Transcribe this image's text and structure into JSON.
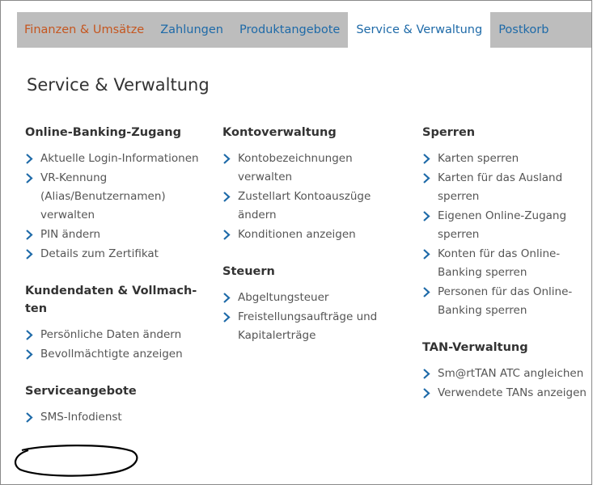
{
  "nav": {
    "tabs": [
      {
        "label": "Finanzen & Umsätze"
      },
      {
        "label": "Zahlungen"
      },
      {
        "label": "Produktangebote"
      },
      {
        "label": "Service & Verwaltung"
      },
      {
        "label": "Postkorb"
      }
    ],
    "active": "Service & Verwaltung"
  },
  "page": {
    "title": "Service & Verwaltung"
  },
  "sections": {
    "online_banking": {
      "heading": "Online-Banking-Zugang",
      "items": [
        "Aktuelle Login-Informationen",
        "VR-Kennung (Alias/Benutzernamen) verwalten",
        "PIN ändern",
        "Details zum Zertifikat"
      ]
    },
    "kundendaten": {
      "heading": "Kundendaten & Vollmach-ten",
      "items": [
        "Persönliche Daten ändern",
        "Bevollmächtigte anzeigen"
      ]
    },
    "serviceangebote": {
      "heading": "Serviceangebote",
      "items": [
        "SMS-Infodienst"
      ]
    },
    "kontoverwaltung": {
      "heading": "Kontoverwaltung",
      "items": [
        "Kontobezeichnungen verwalten",
        "Zustellart Kontoauszüge ändern",
        "Konditionen anzeigen"
      ]
    },
    "steuern": {
      "heading": "Steuern",
      "items": [
        "Abgeltungsteuer",
        "Freistellungsaufträge und Kapitalerträge"
      ]
    },
    "sperren": {
      "heading": "Sperren",
      "items": [
        "Karten sperren",
        "Karten für das Ausland sperren",
        "Eigenen Online-Zugang sperren",
        "Konten für das Online-Banking sperren",
        "Personen für das Online-Banking sperren"
      ]
    },
    "tan": {
      "heading": "TAN-Verwaltung",
      "items": [
        "Sm@rtTAN ATC angleichen",
        "Verwendete TANs anzeigen"
      ]
    }
  },
  "colors": {
    "accent_blue": "#1e6aa8",
    "first_tab_orange": "#c5561f",
    "nav_gray": "#bdbdbd"
  },
  "icons": {
    "list_bullet": "chevron-right-icon",
    "annotation": "hand-drawn-ellipse"
  }
}
